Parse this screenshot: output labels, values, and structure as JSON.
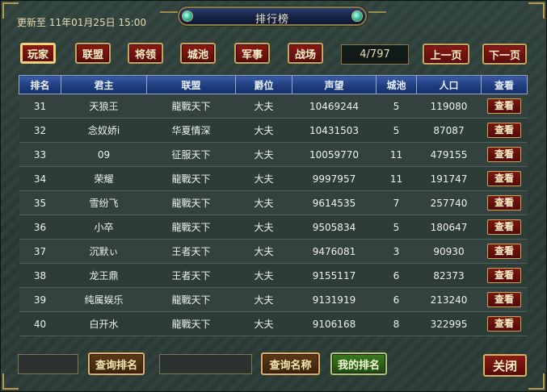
{
  "header": {
    "updated_text": "更新至 11年01月25日 15:00",
    "title": "排行榜"
  },
  "tabs": [
    {
      "label": "玩家",
      "active": true
    },
    {
      "label": "联盟",
      "active": false
    },
    {
      "label": "将领",
      "active": false
    },
    {
      "label": "城池",
      "active": false
    },
    {
      "label": "军事",
      "active": false
    },
    {
      "label": "战场",
      "active": false
    }
  ],
  "pagination": {
    "page_text": "4/797",
    "prev_label": "上一页",
    "next_label": "下一页"
  },
  "table": {
    "columns": [
      "排名",
      "君主",
      "联盟",
      "爵位",
      "声望",
      "城池",
      "人口",
      "查看"
    ],
    "view_label": "查看",
    "rows": [
      [
        "31",
        "天狼王",
        "龍戰天下",
        "大夫",
        "10469244",
        "5",
        "119080"
      ],
      [
        "32",
        "念奴娇i",
        "华夏情深",
        "大夫",
        "10431503",
        "5",
        "87087"
      ],
      [
        "33",
        "09",
        "征服天下",
        "大夫",
        "10059770",
        "11",
        "479155"
      ],
      [
        "34",
        "荣耀",
        "龍戰天下",
        "大夫",
        "9997957",
        "11",
        "191747"
      ],
      [
        "35",
        "雪纷飞",
        "龍戰天下",
        "大夫",
        "9614535",
        "7",
        "257740"
      ],
      [
        "36",
        "小卒",
        "龍戰天下",
        "大夫",
        "9505834",
        "5",
        "180647"
      ],
      [
        "37",
        "沉默ぃ",
        "王者天下",
        "大夫",
        "9476081",
        "3",
        "90930"
      ],
      [
        "38",
        "龙王鼎",
        "王者天下",
        "大夫",
        "9155117",
        "6",
        "82373"
      ],
      [
        "39",
        "纯属娱乐",
        "龍戰天下",
        "大夫",
        "9131919",
        "6",
        "213240"
      ],
      [
        "40",
        "白开水",
        "龍戰天下",
        "大夫",
        "9106168",
        "8",
        "322995"
      ]
    ]
  },
  "footer": {
    "rank_input_value": "",
    "query_rank_label": "查询排名",
    "name_input_value": "",
    "query_name_label": "查询名称",
    "my_rank_label": "我的排名",
    "close_label": "关闭"
  },
  "colors": {
    "button_red": "#7a1812",
    "button_border_gold": "#c9a556",
    "header_blue": "#1d3a7a",
    "my_rank_green": "#3a7a1e"
  }
}
